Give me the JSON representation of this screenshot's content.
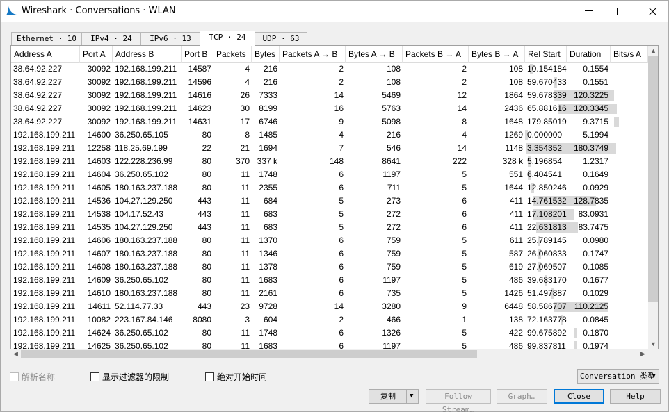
{
  "window": {
    "title": "Wireshark · Conversations · WLAN",
    "minimize": "—",
    "maximize": "☐",
    "close": "✕"
  },
  "tabs": [
    {
      "label": "Ethernet · 10"
    },
    {
      "label": "IPv4 · 24"
    },
    {
      "label": "IPv6 · 13"
    },
    {
      "label": "TCP · 24",
      "active": true
    },
    {
      "label": "UDP · 63"
    }
  ],
  "table": {
    "columns": [
      "Address A",
      "Port A",
      "Address B",
      "Port B",
      "Packets",
      "Bytes",
      "Packets A → B",
      "Bytes A → B",
      "Packets B → A",
      "Bytes B → A",
      "Rel Start",
      "Duration",
      "Bits/s A"
    ],
    "sort_indicator": "^",
    "rows": [
      {
        "cells": [
          "38.64.92.227",
          "30092",
          "192.168.199.211",
          "14587",
          "4",
          "216",
          "2",
          "108",
          "2",
          "108",
          "10.154184",
          "0.1554"
        ],
        "start_frac": 0.045,
        "dur_frac": 0.0
      },
      {
        "cells": [
          "38.64.92.227",
          "30092",
          "192.168.199.211",
          "14596",
          "4",
          "216",
          "2",
          "108",
          "2",
          "108",
          "59.670433",
          "0.1551"
        ],
        "start_frac": 0.265,
        "dur_frac": 0.0
      },
      {
        "cells": [
          "38.64.92.227",
          "30092",
          "192.168.199.211",
          "14616",
          "26",
          "7333",
          "14",
          "5469",
          "12",
          "1864",
          "59.678339",
          "120.3225"
        ],
        "start_frac": 0.265,
        "dur_frac": 0.535
      },
      {
        "cells": [
          "38.64.92.227",
          "30092",
          "192.168.199.211",
          "14623",
          "30",
          "8199",
          "16",
          "5763",
          "14",
          "2436",
          "65.881616",
          "120.3345"
        ],
        "start_frac": 0.293,
        "dur_frac": 0.535
      },
      {
        "cells": [
          "38.64.92.227",
          "30092",
          "192.168.199.211",
          "14631",
          "17",
          "6746",
          "9",
          "5098",
          "8",
          "1648",
          "179.85019(",
          "9.3715"
        ],
        "start_frac": 0.8,
        "dur_frac": 0.042
      },
      {
        "cells": [
          "192.168.199.211",
          "14600",
          "36.250.65.105",
          "80",
          "8",
          "1485",
          "4",
          "216",
          "4",
          "1269",
          "0.000000",
          "5.1994"
        ],
        "start_frac": 0.0,
        "dur_frac": 0.0
      },
      {
        "cells": [
          "192.168.199.211",
          "12258",
          "118.25.69.199",
          "22",
          "21",
          "1694",
          "7",
          "546",
          "14",
          "1148",
          "3.354352",
          "180.3749"
        ],
        "start_frac": 0.015,
        "dur_frac": 0.802
      },
      {
        "cells": [
          "192.168.199.211",
          "14603",
          "122.228.236.99",
          "80",
          "370",
          "337 k",
          "148",
          "8641",
          "222",
          "328 k",
          "5.196854",
          "1.2317"
        ],
        "start_frac": 0.023,
        "dur_frac": 0.0
      },
      {
        "cells": [
          "192.168.199.211",
          "14604",
          "36.250.65.102",
          "80",
          "11",
          "1748",
          "6",
          "1197",
          "5",
          "551",
          "6.404541",
          "0.1649"
        ],
        "start_frac": 0.028,
        "dur_frac": 0.0
      },
      {
        "cells": [
          "192.168.199.211",
          "14605",
          "180.163.237.188",
          "80",
          "11",
          "2355",
          "6",
          "711",
          "5",
          "1644",
          "12.850246",
          "0.0929"
        ],
        "start_frac": 0.057,
        "dur_frac": 0.0
      },
      {
        "cells": [
          "192.168.199.211",
          "14536",
          "104.27.129.250",
          "443",
          "11",
          "684",
          "5",
          "273",
          "6",
          "411",
          "14.761532",
          "128.7835"
        ],
        "start_frac": 0.066,
        "dur_frac": 0.573
      },
      {
        "cells": [
          "192.168.199.211",
          "14538",
          "104.17.52.43",
          "443",
          "11",
          "683",
          "5",
          "272",
          "6",
          "411",
          "17.108201",
          "83.0931"
        ],
        "start_frac": 0.076,
        "dur_frac": 0.369
      },
      {
        "cells": [
          "192.168.199.211",
          "14535",
          "104.27.129.250",
          "443",
          "11",
          "683",
          "5",
          "272",
          "6",
          "411",
          "22.631813",
          "83.7475"
        ],
        "start_frac": 0.1,
        "dur_frac": 0.372
      },
      {
        "cells": [
          "192.168.199.211",
          "14606",
          "180.163.237.188",
          "80",
          "11",
          "1370",
          "6",
          "759",
          "5",
          "611",
          "25.789145",
          "0.0980"
        ],
        "start_frac": 0.115,
        "dur_frac": 0.0
      },
      {
        "cells": [
          "192.168.199.211",
          "14607",
          "180.163.237.188",
          "80",
          "11",
          "1346",
          "6",
          "759",
          "5",
          "587",
          "26.060833",
          "0.1747"
        ],
        "start_frac": 0.116,
        "dur_frac": 0.0
      },
      {
        "cells": [
          "192.168.199.211",
          "14608",
          "180.163.237.188",
          "80",
          "11",
          "1378",
          "6",
          "759",
          "5",
          "619",
          "27.069507",
          "0.1085"
        ],
        "start_frac": 0.12,
        "dur_frac": 0.0
      },
      {
        "cells": [
          "192.168.199.211",
          "14609",
          "36.250.65.102",
          "80",
          "11",
          "1683",
          "6",
          "1197",
          "5",
          "486",
          "39.683170",
          "0.1677"
        ],
        "start_frac": 0.176,
        "dur_frac": 0.0
      },
      {
        "cells": [
          "192.168.199.211",
          "14610",
          "180.163.237.188",
          "80",
          "11",
          "2161",
          "6",
          "735",
          "5",
          "1426",
          "51.497887",
          "0.1029"
        ],
        "start_frac": 0.229,
        "dur_frac": 0.0
      },
      {
        "cells": [
          "192.168.199.211",
          "14611",
          "52.114.77.33",
          "443",
          "23",
          "9728",
          "14",
          "3280",
          "9",
          "6448",
          "58.586707",
          "110.2125"
        ],
        "start_frac": 0.26,
        "dur_frac": 0.49
      },
      {
        "cells": [
          "192.168.199.211",
          "10082",
          "223.167.84.146",
          "8080",
          "3",
          "604",
          "2",
          "466",
          "1",
          "138",
          "72.163778",
          "0.0845"
        ],
        "start_frac": 0.321,
        "dur_frac": 0.0
      },
      {
        "cells": [
          "192.168.199.211",
          "14624",
          "36.250.65.102",
          "80",
          "11",
          "1748",
          "6",
          "1326",
          "5",
          "422",
          "99.675892",
          "0.1870"
        ],
        "start_frac": 0.443,
        "dur_frac": 0.0
      },
      {
        "cells": [
          "192.168.199.211",
          "14625",
          "36.250.65.102",
          "80",
          "11",
          "1683",
          "6",
          "1197",
          "5",
          "486",
          "99.837811",
          "0.1974"
        ],
        "start_frac": 0.444,
        "dur_frac": 0.0
      }
    ]
  },
  "options": {
    "resolve_names": "解析名称",
    "limit_to_filter": "显示过滤器的限制",
    "absolute_start": "绝对开始时间"
  },
  "conv_type_label": "Conversation 类型",
  "buttons": {
    "copy": "复制",
    "follow_stream": "Follow Stream…",
    "graph": "Graph…",
    "close": "Close",
    "help": "Help"
  },
  "icons": {
    "scroll_up": "▲",
    "scroll_down": "▼",
    "scroll_left": "◀",
    "scroll_right": "▶",
    "dropdown": "▼"
  }
}
